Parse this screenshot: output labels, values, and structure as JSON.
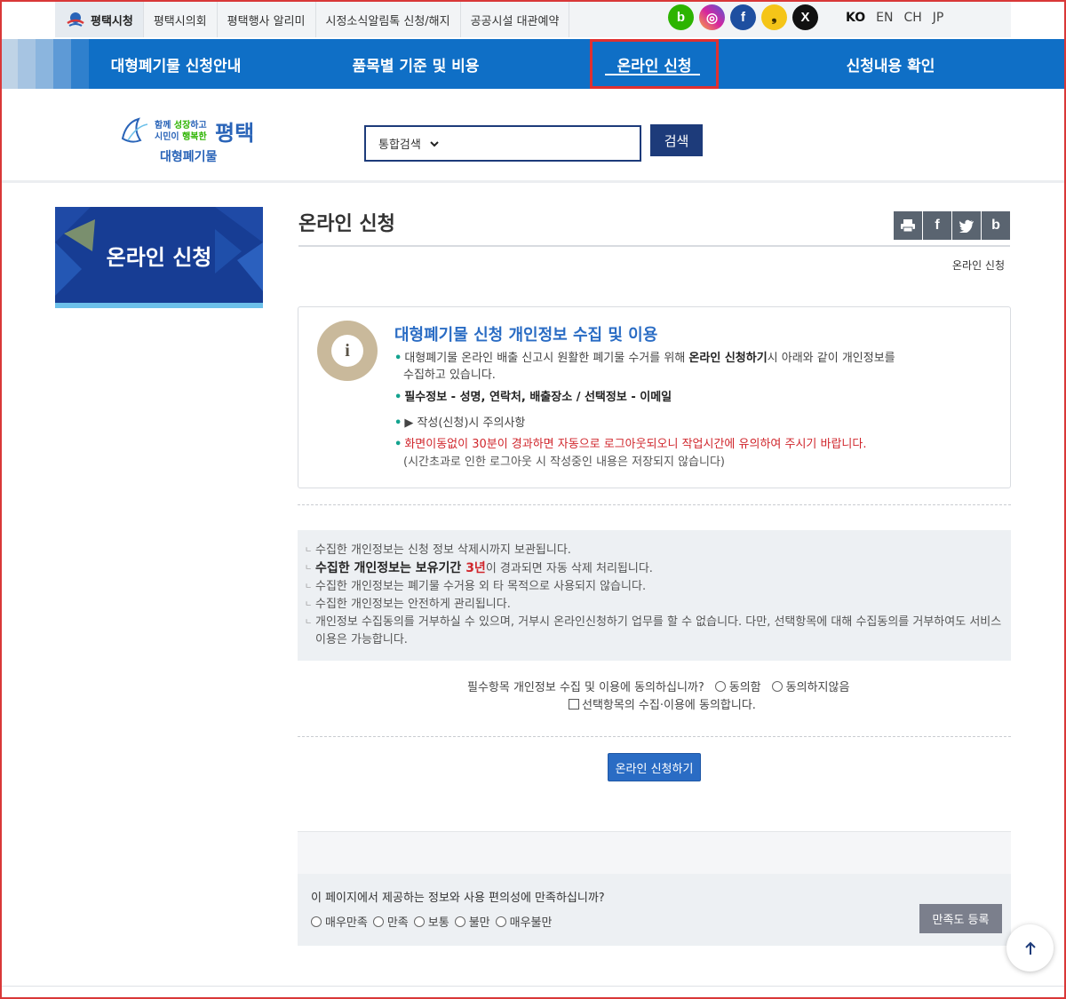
{
  "topbar": {
    "links": [
      {
        "label": "평택시청",
        "active": true
      },
      {
        "label": "평택시의회"
      },
      {
        "label": "평택행사 알리미"
      },
      {
        "label": "시정소식알림톡 신청/해지"
      },
      {
        "label": "공공시설 대관예약"
      }
    ],
    "socials": [
      {
        "icon": "blog-icon",
        "glyph": "b",
        "color": "#2db400"
      },
      {
        "icon": "instagram-icon",
        "glyph": "◎",
        "color": "#d6249f"
      },
      {
        "icon": "facebook-icon",
        "glyph": "f",
        "color": "#1e4fa0"
      },
      {
        "icon": "kakao-story-icon",
        "glyph": "❟",
        "color": "#f5c518"
      },
      {
        "icon": "x-icon",
        "glyph": "X",
        "color": "#111111"
      }
    ],
    "languages": [
      {
        "label": "KO",
        "selected": true
      },
      {
        "label": "EN"
      },
      {
        "label": "CH"
      },
      {
        "label": "JP"
      }
    ]
  },
  "nav": {
    "items": [
      {
        "label": "대형폐기물 신청안내"
      },
      {
        "label": "품목별 기준 및 비용"
      },
      {
        "label": "온라인 신청",
        "current": true
      },
      {
        "label": "신청내용 확인"
      }
    ]
  },
  "brand": {
    "slogan_line1_a": "함께",
    "slogan_line1_b": "성장",
    "slogan_line1_c": "하고",
    "slogan_line2_a": "시민이",
    "slogan_line2_b": "행복한",
    "city": "평택",
    "subtitle": "대형폐기물"
  },
  "search": {
    "scope": "통합검색",
    "button": "검색"
  },
  "sidebar": {
    "title": "온라인 신청"
  },
  "content": {
    "title": "온라인 신청",
    "breadcrumb": "온라인 신청",
    "share": [
      {
        "icon": "print-icon",
        "glyph": "▤"
      },
      {
        "icon": "facebook-icon",
        "glyph": "f"
      },
      {
        "icon": "twitter-icon",
        "glyph": "t"
      },
      {
        "icon": "blog-icon",
        "glyph": "b"
      }
    ]
  },
  "info": {
    "heading": "대형폐기물 신청 개인정보 수집 및 이용",
    "line1_a": "대형폐기물 온라인 배출 신고시 원활한 폐기물 수거를 위해 ",
    "line1_b": "온라인 신청하기",
    "line1_c": "시 아래와 같이 개인정보를",
    "line1_d": "수집하고 있습니다.",
    "line2": "필수정보 - 성명, 연락처, 배출장소 / 선택정보 - 이메일",
    "line3": "▶ 작성(신청)시 주의사항",
    "line4": "화면이동없이 30분이 경과하면 자동으로 로그아웃되오니 작업시간에 유의하여 주시기 바랍니다.",
    "line5": "(시간초과로 인한 로그아웃 시 작성중인 내용은 저장되지 않습니다)"
  },
  "notice": {
    "line1": "수집한 개인정보는 신청 정보 삭제시까지 보관됩니다.",
    "line2_a": "수집한 개인정보는 보유기간 ",
    "line2_b": "3년",
    "line2_c": "이 경과되면 자동 삭제 처리됩니다.",
    "line3": "수집한 개인정보는 폐기물 수거용 외 타 목적으로 사용되지 않습니다.",
    "line4": "수집한 개인정보는 안전하게 관리됩니다.",
    "line5": "개인정보 수집동의를 거부하실 수 있으며, 거부시 온라인신청하기 업무를 할 수 없습니다. 다만, 선택항목에 대해 수집동의를 거부하여도 서비스이용은 가능합니다."
  },
  "consent": {
    "question": "필수항목 개인정보 수집 및 이용에 동의하십니까?",
    "agree": "동의함",
    "disagree": "동의하지않음",
    "optional": "선택항목의 수집·이용에 동의합니다."
  },
  "apply_button": "온라인 신청하기",
  "survey": {
    "question": "이 페이지에서 제공하는 정보와 사용 편의성에 만족하십니까?",
    "options": [
      "매우만족",
      "만족",
      "보통",
      "불만",
      "매우불만"
    ],
    "button": "만족도 등록"
  },
  "to_top": "↑"
}
